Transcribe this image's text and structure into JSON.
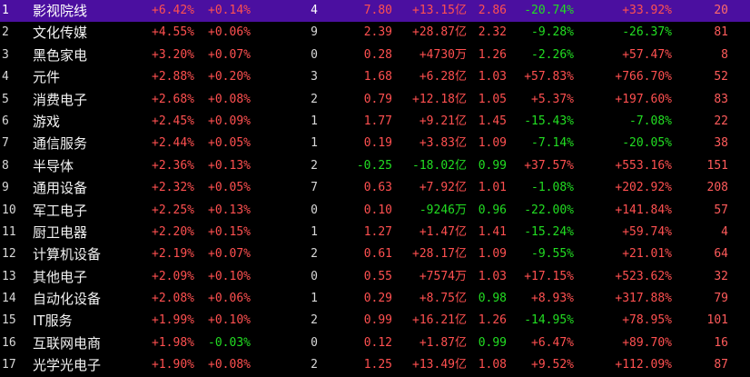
{
  "colors": {
    "background": "#000000",
    "up": "#ff5050",
    "down": "#22dd22",
    "selected_row": "#4b0fa0"
  },
  "rows": [
    {
      "idx": "1",
      "name": "影视院线",
      "c3": "+6.42%",
      "c4": "+0.14%",
      "c5": "4",
      "c6": "7.80",
      "c7": "+13.15亿",
      "c8": "2.86",
      "c9": "-20.74%",
      "c10": "+33.92%",
      "c11": "20",
      "selected": true,
      "colors": {
        "c3": "red",
        "c4": "red",
        "c6": "red",
        "c7": "red",
        "c8": "red",
        "c9": "green",
        "c10": "red"
      }
    },
    {
      "idx": "2",
      "name": "文化传媒",
      "c3": "+4.55%",
      "c4": "+0.06%",
      "c5": "9",
      "c6": "2.39",
      "c7": "+28.87亿",
      "c8": "2.32",
      "c9": "-9.28%",
      "c10": "-26.37%",
      "c11": "81",
      "colors": {
        "c3": "red",
        "c4": "red",
        "c6": "red",
        "c7": "red",
        "c8": "red",
        "c9": "green",
        "c10": "green"
      }
    },
    {
      "idx": "3",
      "name": "黑色家电",
      "c3": "+3.20%",
      "c4": "+0.07%",
      "c5": "0",
      "c6": "0.28",
      "c7": "+4730万",
      "c8": "1.26",
      "c9": "-2.26%",
      "c10": "+57.47%",
      "c11": "8",
      "colors": {
        "c3": "red",
        "c4": "red",
        "c6": "red",
        "c7": "red",
        "c8": "red",
        "c9": "green",
        "c10": "red"
      }
    },
    {
      "idx": "4",
      "name": "元件",
      "c3": "+2.88%",
      "c4": "+0.20%",
      "c5": "3",
      "c6": "1.68",
      "c7": "+6.28亿",
      "c8": "1.03",
      "c9": "+57.83%",
      "c10": "+766.70%",
      "c11": "52",
      "colors": {
        "c3": "red",
        "c4": "red",
        "c6": "red",
        "c7": "red",
        "c8": "red",
        "c9": "red",
        "c10": "red"
      }
    },
    {
      "idx": "5",
      "name": "消费电子",
      "c3": "+2.68%",
      "c4": "+0.08%",
      "c5": "2",
      "c6": "0.79",
      "c7": "+12.18亿",
      "c8": "1.05",
      "c9": "+5.37%",
      "c10": "+197.60%",
      "c11": "83",
      "colors": {
        "c3": "red",
        "c4": "red",
        "c6": "red",
        "c7": "red",
        "c8": "red",
        "c9": "red",
        "c10": "red"
      }
    },
    {
      "idx": "6",
      "name": "游戏",
      "c3": "+2.45%",
      "c4": "+0.09%",
      "c5": "1",
      "c6": "1.77",
      "c7": "+9.21亿",
      "c8": "1.45",
      "c9": "-15.43%",
      "c10": "-7.08%",
      "c11": "22",
      "colors": {
        "c3": "red",
        "c4": "red",
        "c6": "red",
        "c7": "red",
        "c8": "red",
        "c9": "green",
        "c10": "green"
      }
    },
    {
      "idx": "7",
      "name": "通信服务",
      "c3": "+2.44%",
      "c4": "+0.05%",
      "c5": "1",
      "c6": "0.19",
      "c7": "+3.83亿",
      "c8": "1.09",
      "c9": "-7.14%",
      "c10": "-20.05%",
      "c11": "38",
      "colors": {
        "c3": "red",
        "c4": "red",
        "c6": "red",
        "c7": "red",
        "c8": "red",
        "c9": "green",
        "c10": "green"
      }
    },
    {
      "idx": "8",
      "name": "半导体",
      "c3": "+2.36%",
      "c4": "+0.13%",
      "c5": "2",
      "c6": "-0.25",
      "c7": "-18.02亿",
      "c8": "0.99",
      "c9": "+37.57%",
      "c10": "+553.16%",
      "c11": "151",
      "colors": {
        "c3": "red",
        "c4": "red",
        "c6": "green",
        "c7": "green",
        "c8": "green",
        "c9": "red",
        "c10": "red"
      }
    },
    {
      "idx": "9",
      "name": "通用设备",
      "c3": "+2.32%",
      "c4": "+0.05%",
      "c5": "7",
      "c6": "0.63",
      "c7": "+7.92亿",
      "c8": "1.01",
      "c9": "-1.08%",
      "c10": "+202.92%",
      "c11": "208",
      "colors": {
        "c3": "red",
        "c4": "red",
        "c6": "red",
        "c7": "red",
        "c8": "red",
        "c9": "green",
        "c10": "red"
      }
    },
    {
      "idx": "10",
      "name": "军工电子",
      "c3": "+2.25%",
      "c4": "+0.13%",
      "c5": "0",
      "c6": "0.10",
      "c7": "-9246万",
      "c8": "0.96",
      "c9": "-22.00%",
      "c10": "+141.84%",
      "c11": "57",
      "colors": {
        "c3": "red",
        "c4": "red",
        "c6": "red",
        "c7": "green",
        "c8": "green",
        "c9": "green",
        "c10": "red"
      }
    },
    {
      "idx": "11",
      "name": "厨卫电器",
      "c3": "+2.20%",
      "c4": "+0.15%",
      "c5": "1",
      "c6": "1.27",
      "c7": "+1.47亿",
      "c8": "1.41",
      "c9": "-15.24%",
      "c10": "+59.74%",
      "c11": "4",
      "colors": {
        "c3": "red",
        "c4": "red",
        "c6": "red",
        "c7": "red",
        "c8": "red",
        "c9": "green",
        "c10": "red"
      }
    },
    {
      "idx": "12",
      "name": "计算机设备",
      "c3": "+2.19%",
      "c4": "+0.07%",
      "c5": "2",
      "c6": "0.61",
      "c7": "+28.17亿",
      "c8": "1.09",
      "c9": "-9.55%",
      "c10": "+21.01%",
      "c11": "64",
      "colors": {
        "c3": "red",
        "c4": "red",
        "c6": "red",
        "c7": "red",
        "c8": "red",
        "c9": "green",
        "c10": "red"
      }
    },
    {
      "idx": "13",
      "name": "其他电子",
      "c3": "+2.09%",
      "c4": "+0.10%",
      "c5": "0",
      "c6": "0.55",
      "c7": "+7574万",
      "c8": "1.03",
      "c9": "+17.15%",
      "c10": "+523.62%",
      "c11": "32",
      "colors": {
        "c3": "red",
        "c4": "red",
        "c6": "red",
        "c7": "red",
        "c8": "red",
        "c9": "red",
        "c10": "red"
      }
    },
    {
      "idx": "14",
      "name": "自动化设备",
      "c3": "+2.08%",
      "c4": "+0.06%",
      "c5": "1",
      "c6": "0.29",
      "c7": "+8.75亿",
      "c8": "0.98",
      "c9": "+8.93%",
      "c10": "+317.88%",
      "c11": "79",
      "colors": {
        "c3": "red",
        "c4": "red",
        "c6": "red",
        "c7": "red",
        "c8": "green",
        "c9": "red",
        "c10": "red"
      }
    },
    {
      "idx": "15",
      "name": "IT服务",
      "c3": "+1.99%",
      "c4": "+0.10%",
      "c5": "2",
      "c6": "0.99",
      "c7": "+16.21亿",
      "c8": "1.26",
      "c9": "-14.95%",
      "c10": "+78.95%",
      "c11": "101",
      "colors": {
        "c3": "red",
        "c4": "red",
        "c6": "red",
        "c7": "red",
        "c8": "red",
        "c9": "green",
        "c10": "red"
      }
    },
    {
      "idx": "16",
      "name": "互联网电商",
      "c3": "+1.98%",
      "c4": "-0.03%",
      "c5": "0",
      "c6": "0.12",
      "c7": "+1.87亿",
      "c8": "0.99",
      "c9": "+6.47%",
      "c10": "+89.70%",
      "c11": "16",
      "colors": {
        "c3": "red",
        "c4": "green",
        "c6": "red",
        "c7": "red",
        "c8": "green",
        "c9": "red",
        "c10": "red"
      }
    },
    {
      "idx": "17",
      "name": "光学光电子",
      "c3": "+1.90%",
      "c4": "+0.08%",
      "c5": "2",
      "c6": "1.25",
      "c7": "+13.49亿",
      "c8": "1.08",
      "c9": "+9.52%",
      "c10": "+112.09%",
      "c11": "87",
      "colors": {
        "c3": "red",
        "c4": "red",
        "c6": "red",
        "c7": "red",
        "c8": "red",
        "c9": "red",
        "c10": "red"
      }
    }
  ]
}
